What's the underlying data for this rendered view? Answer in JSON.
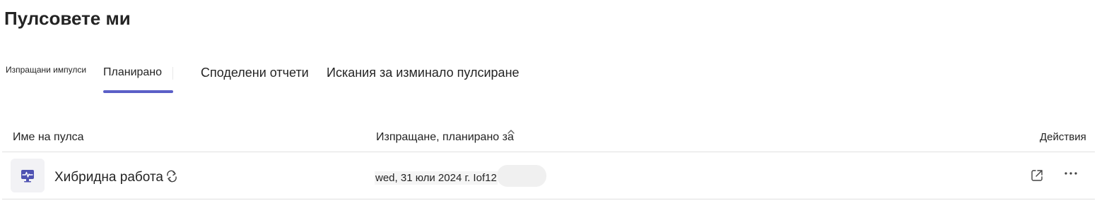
{
  "page": {
    "title": "Пулсовете ми"
  },
  "tabs": [
    {
      "label": "Изпращани импулси",
      "selected": false
    },
    {
      "label": "Планирано",
      "selected": true
    },
    {
      "label": "Споделени отчети",
      "selected": false
    },
    {
      "label": "Искания за изминало пулсиране",
      "selected": false
    }
  ],
  "table": {
    "columns": {
      "name": "Име на пулса",
      "scheduled": "Изпращане, планирано за",
      "actions": "Действия"
    },
    "rows": [
      {
        "name": "Хибридна работа",
        "scheduled_for": "wed, 31 юли 2024 г. Iof12",
        "recurring": true,
        "icon": "pulse-survey-icon"
      }
    ]
  },
  "colors": {
    "accent": "#5b5fc7",
    "divider": "#e0e0e0",
    "text": "#242424"
  },
  "icons": {
    "sort": "chevron-up-icon",
    "recurring": "recurring-icon",
    "open": "open-in-new-icon",
    "more": "more-horizontal-icon"
  }
}
